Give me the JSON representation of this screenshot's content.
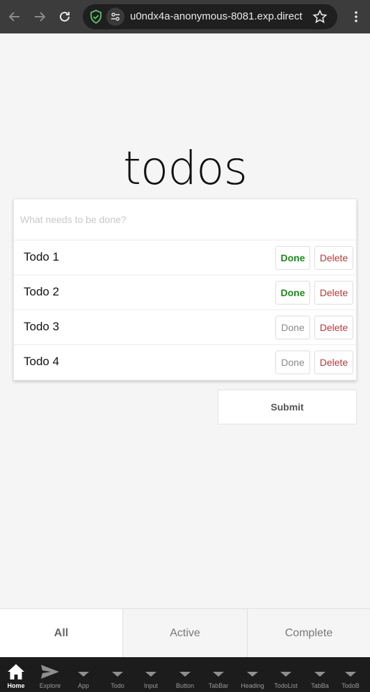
{
  "browser": {
    "url": "u0ndx4a-anonymous-8081.exp.direct"
  },
  "app": {
    "title": "todos",
    "input_placeholder": "What needs to be done?",
    "todos": [
      {
        "label": "Todo 1",
        "done_label": "Done",
        "delete_label": "Delete",
        "done": true
      },
      {
        "label": "Todo 2",
        "done_label": "Done",
        "delete_label": "Delete",
        "done": true
      },
      {
        "label": "Todo 3",
        "done_label": "Done",
        "delete_label": "Delete",
        "done": false
      },
      {
        "label": "Todo 4",
        "done_label": "Done",
        "delete_label": "Delete",
        "done": false
      }
    ],
    "submit_label": "Submit"
  },
  "filters": {
    "all": "All",
    "active": "Active",
    "complete": "Complete",
    "selected": "All"
  },
  "bottom_nav": {
    "items": [
      {
        "label": "Home",
        "icon": "home-icon"
      },
      {
        "label": "Explore",
        "icon": "send-icon"
      },
      {
        "label": "App",
        "icon": "triangle-icon"
      },
      {
        "label": "Todo",
        "icon": "triangle-icon"
      },
      {
        "label": "Input",
        "icon": "triangle-icon"
      },
      {
        "label": "Button",
        "icon": "triangle-icon"
      },
      {
        "label": "TabBar",
        "icon": "triangle-icon"
      },
      {
        "label": "Heading",
        "icon": "triangle-icon"
      },
      {
        "label": "TodoList",
        "icon": "triangle-icon"
      },
      {
        "label": "TabBa",
        "icon": "triangle-icon"
      },
      {
        "label": "TodoB",
        "icon": "triangle-icon"
      }
    ]
  },
  "colors": {
    "done_active": "#1a8a1a",
    "delete": "#b23a3a",
    "browser_bar": "#3c3c3c",
    "bottom_nav": "#1c1c1c"
  }
}
